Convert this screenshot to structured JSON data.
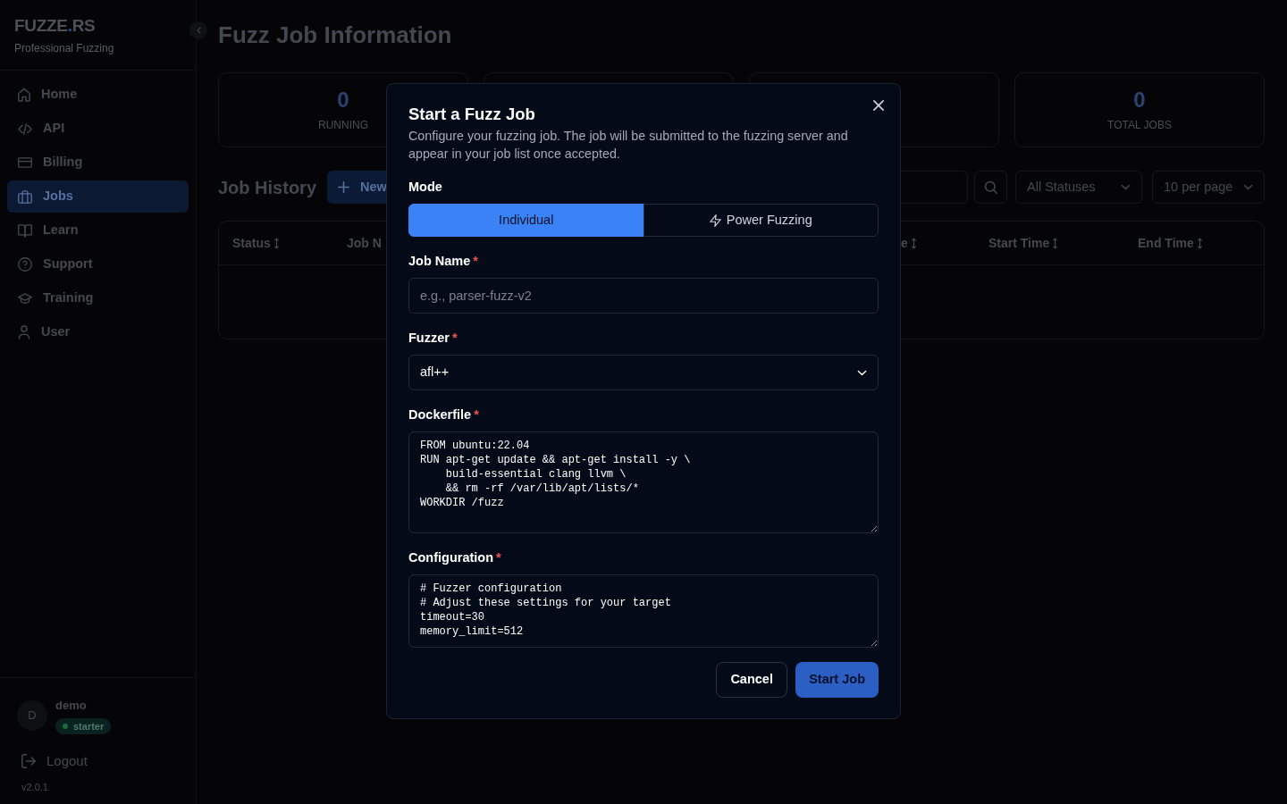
{
  "sidebar": {
    "logo": {
      "brand": "FUZZE",
      "dot": ".",
      "suffix": "RS"
    },
    "tagline": "Professional Fuzzing",
    "nav": [
      {
        "label": "Home",
        "selected": false
      },
      {
        "label": "API",
        "selected": false
      },
      {
        "label": "Billing",
        "selected": false
      },
      {
        "label": "Jobs",
        "selected": true
      },
      {
        "label": "Learn",
        "selected": false
      },
      {
        "label": "Support",
        "selected": false
      },
      {
        "label": "Training",
        "selected": false
      },
      {
        "label": "User",
        "selected": false
      }
    ],
    "user": {
      "initial": "D",
      "name": "demo",
      "plan": "starter"
    },
    "logout": "Logout",
    "version": "v2.0.1"
  },
  "page": {
    "title": "Fuzz Job Information",
    "stats": [
      {
        "value": "0",
        "label": "RUNNING"
      },
      {
        "value": "0",
        "label": "TOTAL JOBS"
      }
    ],
    "history": {
      "title": "Job History",
      "new_button": "New",
      "status_filter": "All Statuses",
      "page_size": "10 per page"
    },
    "table": {
      "columns": [
        "Status",
        "Job N",
        "e",
        "Start Time",
        "End Time"
      ]
    }
  },
  "modal": {
    "title": "Start a Fuzz Job",
    "description": "Configure your fuzzing job. The job will be submitted to the fuzzing server and appear in your job list once accepted.",
    "mode": {
      "label": "Mode",
      "options": [
        {
          "label": "Individual",
          "selected": true
        },
        {
          "label": "Power Fuzzing",
          "selected": false
        }
      ]
    },
    "fields": [
      {
        "kind": "input",
        "label": "Job Name",
        "required_mark": "*",
        "placeholder": "e.g., parser-fuzz-v2"
      },
      {
        "kind": "select",
        "label": "Fuzzer",
        "required_mark": "*",
        "value": "afl++"
      },
      {
        "kind": "textarea",
        "label": "Dockerfile",
        "required_mark": "*",
        "value": "FROM ubuntu:22.04\nRUN apt-get update && apt-get install -y \\\n    build-essential clang llvm \\\n    && rm -rf /var/lib/apt/lists/*\nWORKDIR /fuzz"
      },
      {
        "kind": "textarea",
        "label": "Configuration",
        "required_mark": "*",
        "value": "# Fuzzer configuration\n# Adjust these settings for your target\ntimeout=30\nmemory_limit=512"
      }
    ],
    "buttons": [
      {
        "label": "Cancel",
        "kind": "secondary",
        "disabled": false
      },
      {
        "label": "Start Job",
        "kind": "primary",
        "disabled": true
      }
    ]
  }
}
